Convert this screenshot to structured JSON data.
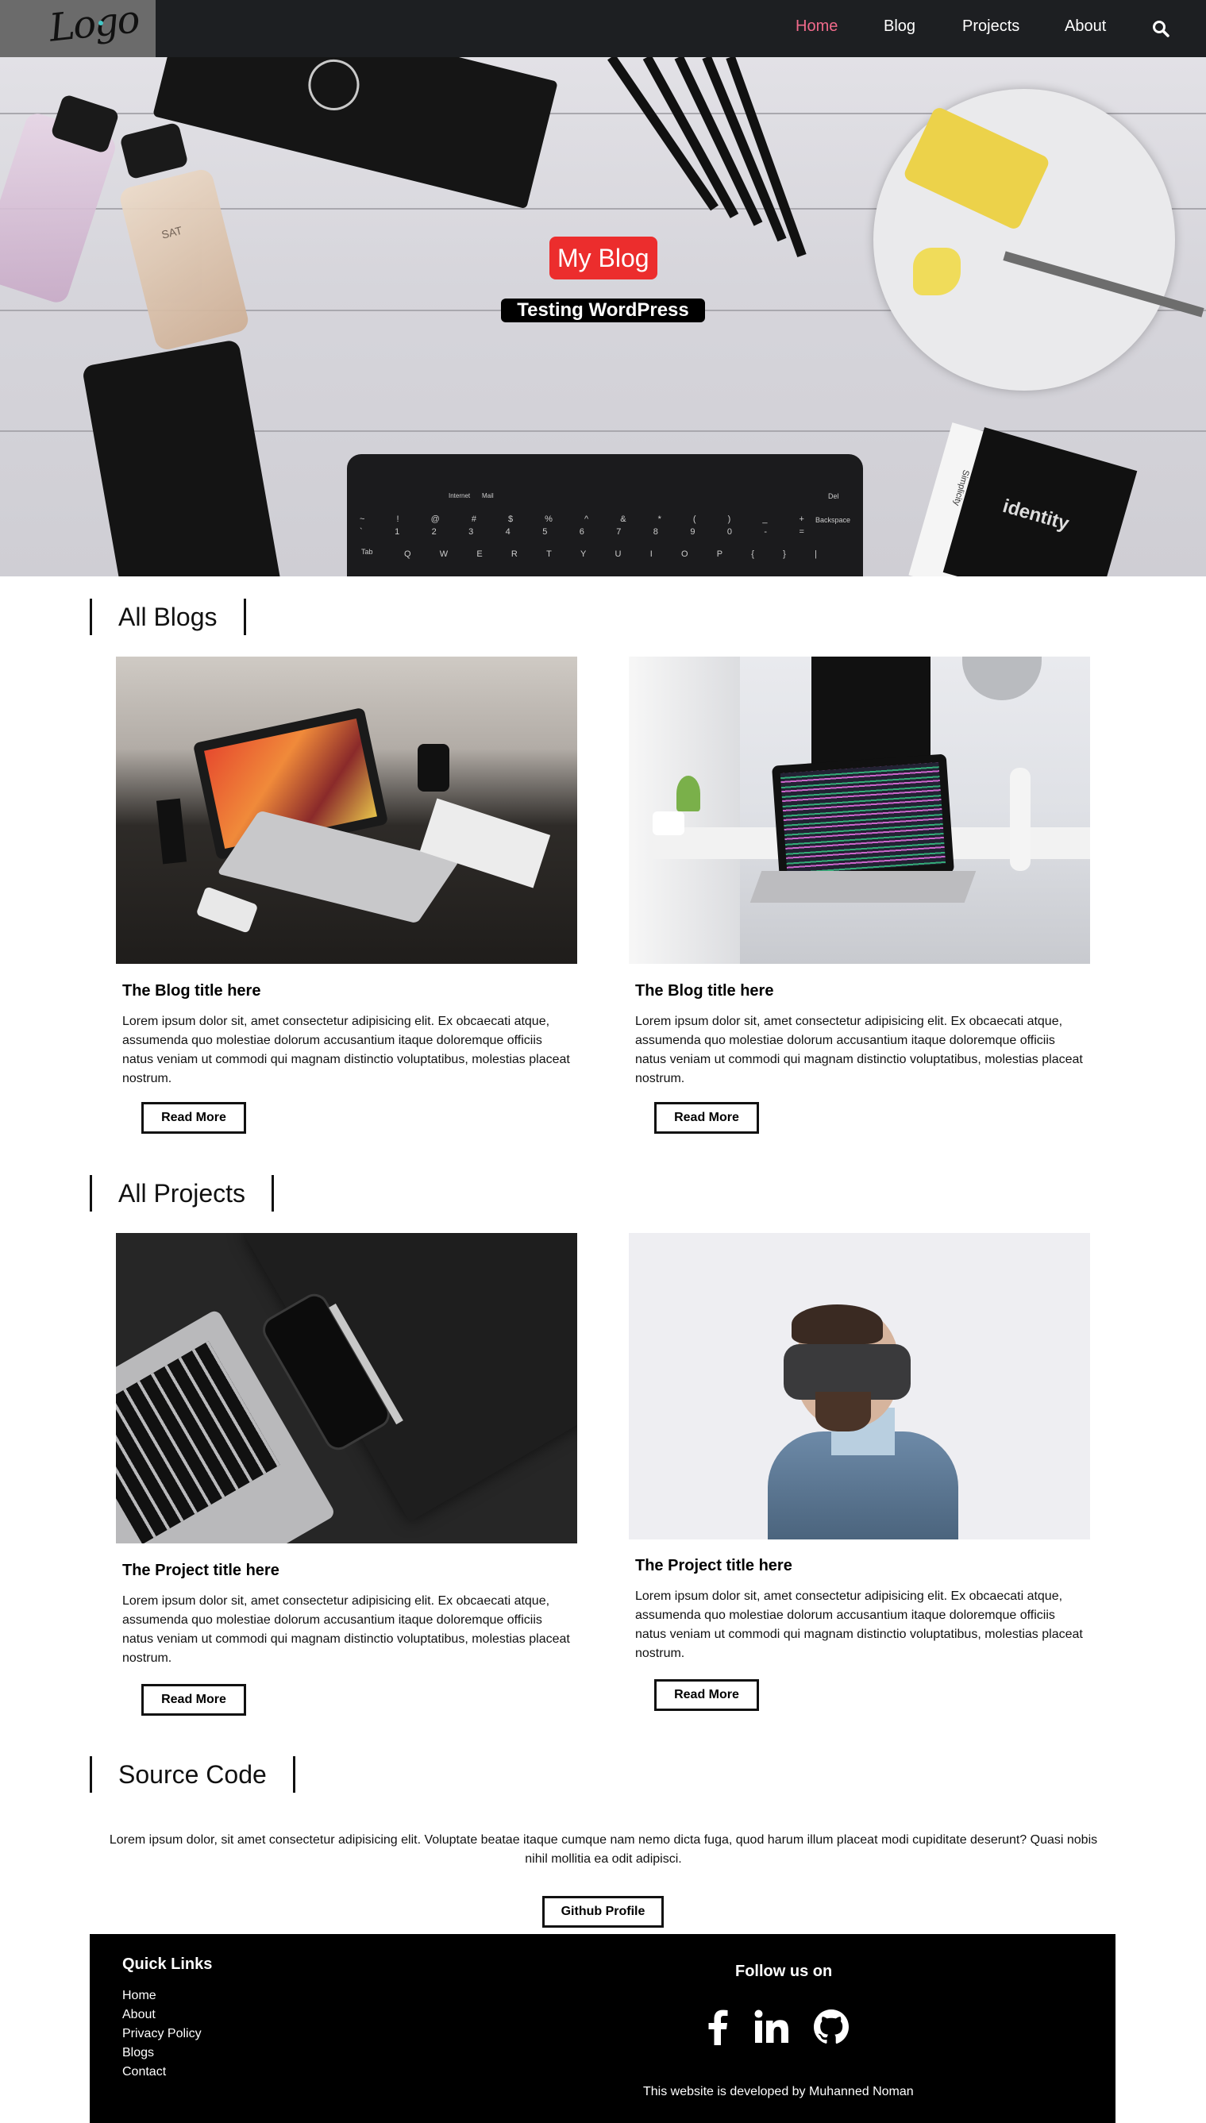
{
  "logo": {
    "text": "Logo"
  },
  "nav": {
    "items": [
      {
        "label": "Home",
        "active": true
      },
      {
        "label": "Blog"
      },
      {
        "label": "Projects"
      },
      {
        "label": "About"
      }
    ],
    "search_icon": "search-icon",
    "active_color": "#f06a8b"
  },
  "hero": {
    "title": "My Blog",
    "subtitle": "Testing WordPress",
    "title_bg": "#ec2d2d",
    "keyboard_row1": [
      "Internet",
      "Mail"
    ],
    "keyboard_keys": [
      "~",
      "!",
      "@",
      "#",
      "$",
      "%",
      "^",
      "&",
      "*",
      "(",
      ")",
      "_",
      "+"
    ],
    "keyboard_nums": [
      "`",
      "1",
      "2",
      "3",
      "4",
      "5",
      "6",
      "7",
      "8",
      "9",
      "0",
      "-",
      "="
    ],
    "keyboard_qrow": [
      "Q",
      "W",
      "E",
      "R",
      "T",
      "Y",
      "U",
      "I",
      "O",
      "P",
      "{",
      "}",
      "|"
    ],
    "keyboard_special": {
      "backspace": "Backspace",
      "del": "Del",
      "tab": "Tab"
    },
    "box_label": "identity",
    "box_side": "Simplicity",
    "perfume_label": "SAT"
  },
  "blogs": {
    "heading": "All Blogs",
    "cards": [
      {
        "title": "The Blog title here",
        "text": "Lorem ipsum dolor sit, amet consectetur adipisicing elit. Ex obcaecati atque, assumenda quo molestiae dolorum accusantium itaque doloremque officiis natus veniam ut commodi qui magnam distinctio voluptatibus, molestias placeat nostrum.",
        "button": "Read More"
      },
      {
        "title": "The Blog title here",
        "text": "Lorem ipsum dolor sit, amet consectetur adipisicing elit. Ex obcaecati atque, assumenda quo molestiae dolorum accusantium itaque doloremque officiis natus veniam ut commodi qui magnam distinctio voluptatibus, molestias placeat nostrum.",
        "button": "Read More"
      }
    ]
  },
  "projects": {
    "heading": "All Projects",
    "cards": [
      {
        "title": "The Project title here",
        "text": "Lorem ipsum dolor sit, amet consectetur adipisicing elit. Ex obcaecati atque, assumenda quo molestiae dolorum accusantium itaque doloremque officiis natus veniam ut commodi qui magnam distinctio voluptatibus, molestias placeat nostrum.",
        "button": "Read More"
      },
      {
        "title": "The Project title here",
        "text": "Lorem ipsum dolor sit, amet consectetur adipisicing elit. Ex obcaecati atque, assumenda quo molestiae dolorum accusantium itaque doloremque officiis natus veniam ut commodi qui magnam distinctio voluptatibus, molestias placeat nostrum.",
        "button": "Read More"
      }
    ]
  },
  "source": {
    "heading": "Source Code",
    "text": "Lorem ipsum dolor, sit amet consectetur adipisicing elit. Voluptate beatae itaque cumque nam nemo dicta fuga, quod harum illum placeat modi cupiditate deserunt? Quasi nobis nihil mollitia ea odit adipisci.",
    "button": "Github Profile"
  },
  "footer": {
    "quick_links_title": "Quick Links",
    "links": [
      "Home",
      "About",
      "Privacy Policy",
      "Blogs",
      "Contact"
    ],
    "follow_title": "Follow us on",
    "social_icons": [
      "facebook-icon",
      "linkedin-icon",
      "github-icon"
    ],
    "credit": "This website is developed by Muhanned Noman"
  }
}
